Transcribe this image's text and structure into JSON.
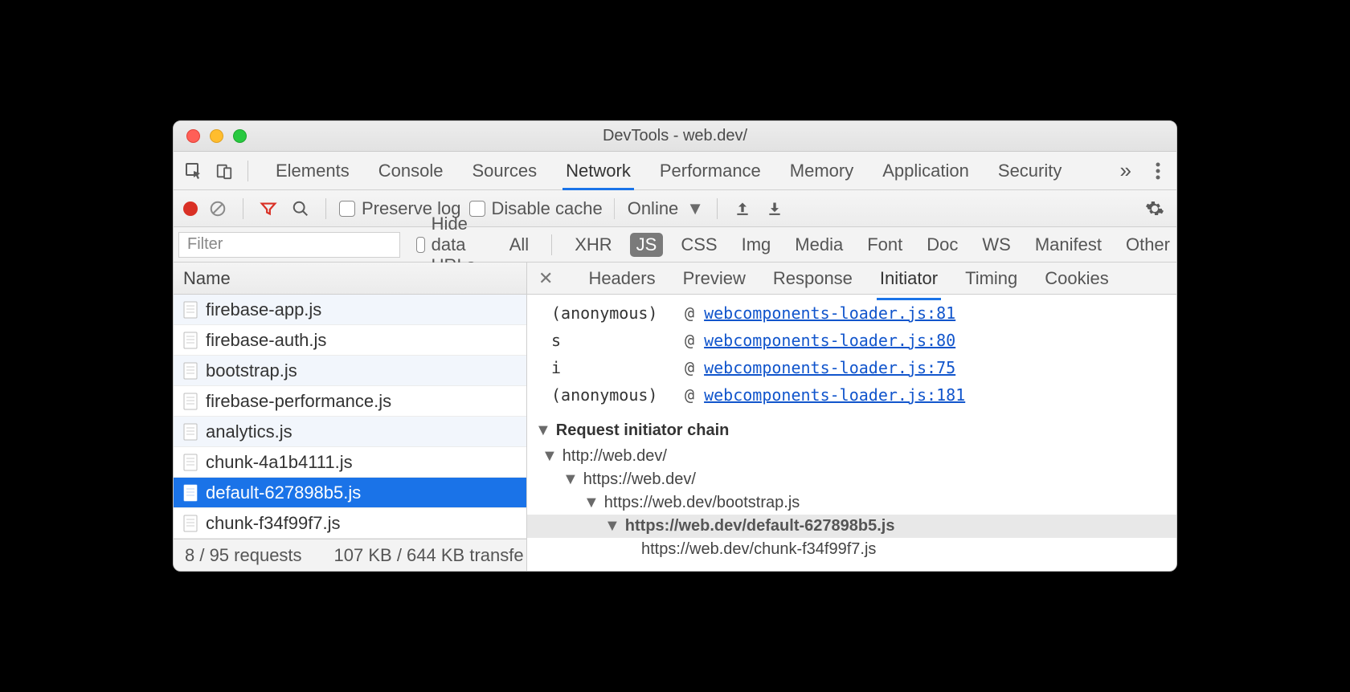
{
  "window": {
    "title": "DevTools - web.dev/"
  },
  "main_tabs": [
    "Elements",
    "Console",
    "Sources",
    "Network",
    "Performance",
    "Memory",
    "Application",
    "Security"
  ],
  "main_tab_active": 3,
  "toolbar": {
    "preserve_log": "Preserve log",
    "disable_cache": "Disable cache",
    "throttling": "Online"
  },
  "filter": {
    "placeholder": "Filter",
    "hide_data_urls": "Hide data URLs",
    "types": [
      "All",
      "XHR",
      "JS",
      "CSS",
      "Img",
      "Media",
      "Font",
      "Doc",
      "WS",
      "Manifest",
      "Other"
    ],
    "type_selected": 2
  },
  "left": {
    "header": "Name",
    "requests": [
      "firebase-app.js",
      "firebase-auth.js",
      "bootstrap.js",
      "firebase-performance.js",
      "analytics.js",
      "chunk-4a1b4111.js",
      "default-627898b5.js",
      "chunk-f34f99f7.js"
    ],
    "selected": 6,
    "status_requests": "8 / 95 requests",
    "status_transfer": "107 KB / 644 KB transfe"
  },
  "detail": {
    "tabs": [
      "Headers",
      "Preview",
      "Response",
      "Initiator",
      "Timing",
      "Cookies"
    ],
    "tab_active": 3,
    "stack": [
      {
        "fn": "(anonymous)",
        "at": "@",
        "link": "webcomponents-loader.js:81"
      },
      {
        "fn": "s",
        "at": "@",
        "link": "webcomponents-loader.js:80"
      },
      {
        "fn": "i",
        "at": "@",
        "link": "webcomponents-loader.js:75"
      },
      {
        "fn": "(anonymous)",
        "at": "@",
        "link": "webcomponents-loader.js:181"
      }
    ],
    "section_title": "Request initiator chain",
    "chain": [
      {
        "indent": 0,
        "text": "http://web.dev/",
        "caret": true
      },
      {
        "indent": 1,
        "text": "https://web.dev/",
        "caret": true
      },
      {
        "indent": 2,
        "text": "https://web.dev/bootstrap.js",
        "caret": true
      },
      {
        "indent": 3,
        "text": "https://web.dev/default-627898b5.js",
        "caret": true,
        "current": true
      },
      {
        "indent": 4,
        "text": "https://web.dev/chunk-f34f99f7.js",
        "caret": false
      }
    ]
  }
}
